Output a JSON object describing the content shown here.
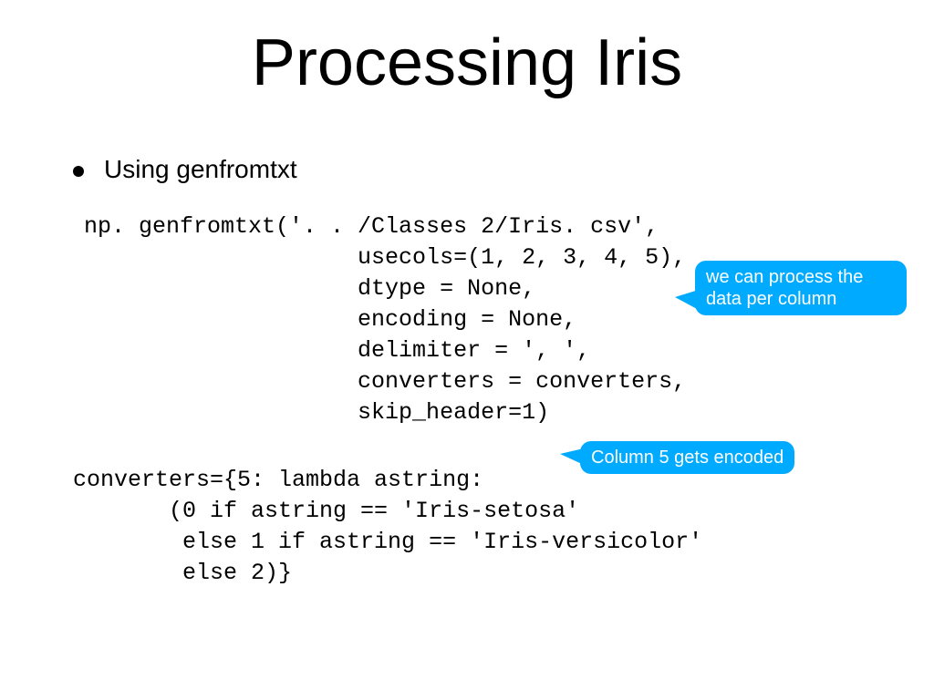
{
  "title": "Processing Iris",
  "bullet": "Using genfromtxt",
  "code_block_1": "np. genfromtxt('. . /Classes 2/Iris. csv',\n                    usecols=(1, 2, 3, 4, 5),\n                    dtype = None,\n                    encoding = None,\n                    delimiter = ', ',\n                    converters = converters,\n                    skip_header=1)",
  "code_block_2": "converters={5: lambda astring:\n       (0 if astring == 'Iris-setosa'\n        else 1 if astring == 'Iris-versicolor'\n        else 2)}",
  "callouts": {
    "c1_line1": "we can process the",
    "c1_line2": "data per column",
    "c2": "Column 5 gets encoded"
  }
}
